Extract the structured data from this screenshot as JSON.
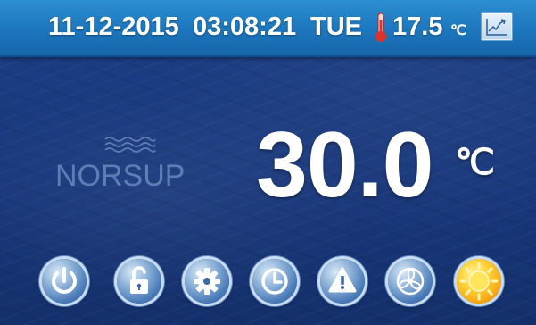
{
  "status_bar": {
    "date": "11-12-2015",
    "time": "03:08:21",
    "weekday": "TUE",
    "outdoor_temp": "17.5",
    "outdoor_unit": "℃",
    "thermometer_icon": "thermometer-icon",
    "trend_icon": "trend-chart-icon"
  },
  "brand": {
    "name": "NORSUP",
    "waves_icon": "waves-icon"
  },
  "main": {
    "setpoint": "30.0",
    "unit": "℃"
  },
  "controls": [
    {
      "icon": "power-icon"
    },
    {
      "icon": "unlock-icon"
    },
    {
      "icon": "gear-icon"
    },
    {
      "icon": "clock-icon"
    },
    {
      "icon": "warning-icon"
    },
    {
      "icon": "fan-icon"
    },
    {
      "icon": "sun-icon"
    }
  ],
  "colors": {
    "background": "#1d3f86",
    "status_bar": "#1d76bd",
    "text": "#ffffff",
    "brand": "#5e7db4",
    "thermometer": "#e0322b",
    "mode_active": "#ffd43a"
  }
}
